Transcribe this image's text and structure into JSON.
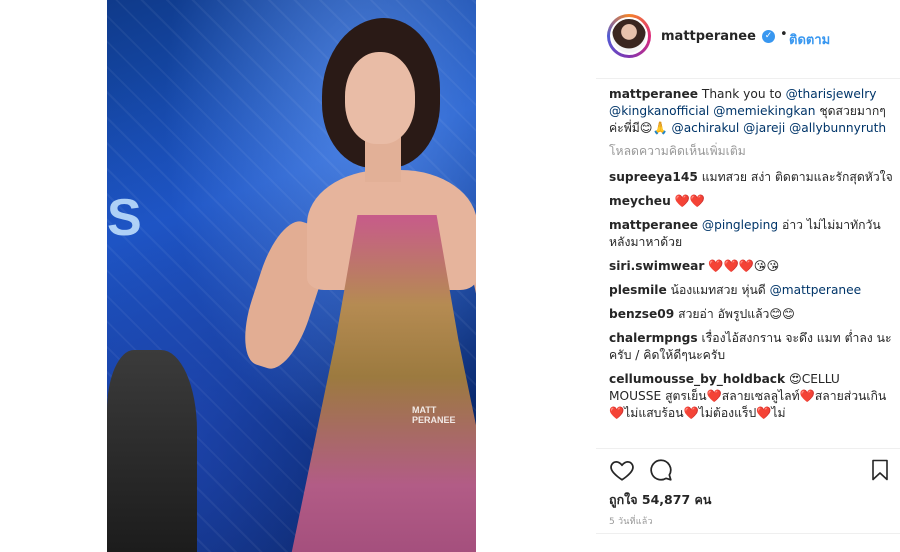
{
  "post": {
    "username": "mattperanee",
    "verified_glyph": "✓",
    "separator": "•",
    "follow_label": "ติดตาม",
    "watermark": "MATT PERANEE",
    "stage_text": "S"
  },
  "caption": {
    "user": "mattperanee",
    "parts": [
      {
        "text": "Thank you to ",
        "type": "text"
      },
      {
        "text": "@tharisjewelry",
        "type": "mention"
      },
      {
        "text": " ",
        "type": "text"
      },
      {
        "text": "@kingkanofficial",
        "type": "mention"
      },
      {
        "text": " ",
        "type": "text"
      },
      {
        "text": "@memiekingkan",
        "type": "mention"
      },
      {
        "text": " ชุดสวยมากๆค่ะพี่มี😊🙏 ",
        "type": "text"
      },
      {
        "text": "@achirakul",
        "type": "mention"
      },
      {
        "text": " ",
        "type": "text"
      },
      {
        "text": "@jareji",
        "type": "mention"
      },
      {
        "text": " ",
        "type": "text"
      },
      {
        "text": "@allybunnyruth",
        "type": "mention"
      }
    ]
  },
  "load_more": "โหลดความคิดเห็นเพิ่มเติม",
  "comments": [
    {
      "user": "supreeya145",
      "parts": [
        {
          "text": "แมทสวย สง่า ติดตามและรักสุดหัวใจ",
          "type": "text"
        }
      ]
    },
    {
      "user": "meycheu",
      "parts": [
        {
          "text": "❤️❤️",
          "type": "text"
        }
      ]
    },
    {
      "user": "mattperanee",
      "parts": [
        {
          "text": "@pingleping",
          "type": "mention"
        },
        {
          "text": " อ่าว ไม่ไม่มาทักวันหลังมาหาด้วย",
          "type": "text"
        }
      ]
    },
    {
      "user": "siri.swimwear",
      "parts": [
        {
          "text": "❤️❤️❤️😘😘",
          "type": "text"
        }
      ]
    },
    {
      "user": "plesmile",
      "parts": [
        {
          "text": "น้องแมทสวย หุ่นดี ",
          "type": "text"
        },
        {
          "text": "@mattperanee",
          "type": "mention"
        }
      ]
    },
    {
      "user": "benzse09",
      "parts": [
        {
          "text": "สวยอ่า อัพรูปแล้ว😊😊",
          "type": "text"
        }
      ]
    },
    {
      "user": "chalermpngs",
      "parts": [
        {
          "text": "เรื่องไอ้สงกราน จะดึง แมท ต่ำลง นะครับ / คิดให้ดีๆนะครับ",
          "type": "text"
        }
      ]
    },
    {
      "user": "cellumousse_by_holdback",
      "parts": [
        {
          "text": "😍CELLU MOUSSE สูตรเย็น❤️สลายเซลลูไลท์❤️สลายส่วนเกิน❤️ไม่แสบร้อน❤️ไม่ต้องแร็ป❤️ไม่",
          "type": "text"
        }
      ]
    }
  ],
  "likes": "ถูกใจ 54,877 คน",
  "time_ago": "5 วันที่แล้ว",
  "colors": {
    "link": "#3897f0",
    "mention": "#003569",
    "muted": "#999999",
    "text": "#262626"
  }
}
